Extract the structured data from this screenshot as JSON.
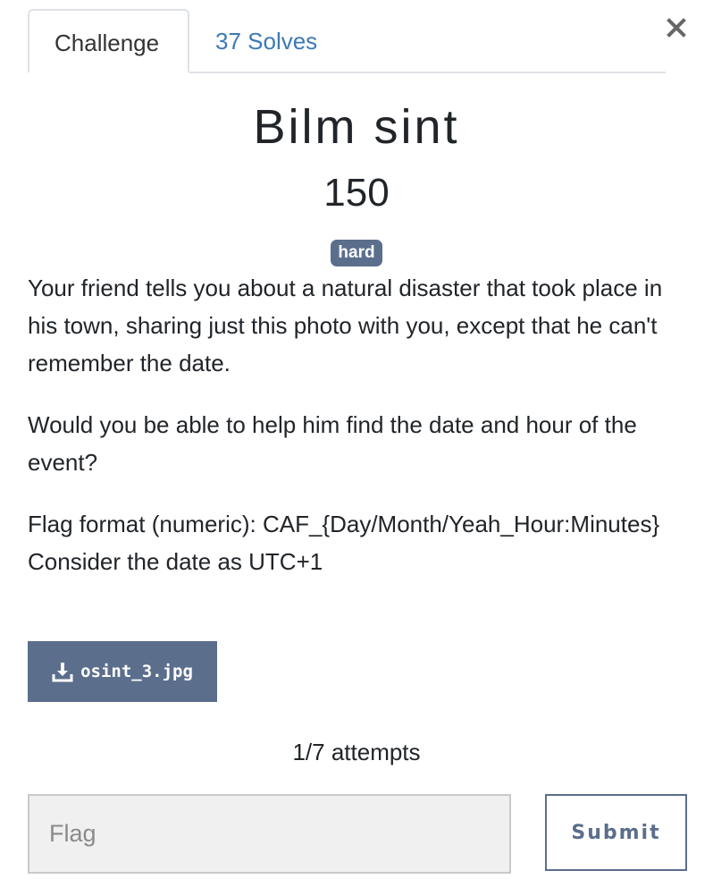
{
  "tabs": [
    {
      "label": "Challenge",
      "active": true
    },
    {
      "label": "37 Solves",
      "active": false
    }
  ],
  "close_icon": "close-icon",
  "challenge": {
    "name": "Bilm sint",
    "points": "150",
    "difficulty": "hard",
    "description": [
      "Your friend tells you about a natural disaster that took place in his town, sharing just this photo with you, except that he can't remember the date.",
      "Would you be able to help him find the date and hour of the event?",
      "Flag format (numeric): CAF_{Day/Month/Yeah_Hour:Minutes} Consider the date as UTC+1"
    ]
  },
  "download": {
    "icon": "download-icon",
    "filename": "osint_3.jpg"
  },
  "attempts": "1/7 attempts",
  "form": {
    "flag_placeholder": "Flag",
    "flag_value": "",
    "submit_label": "Submit"
  },
  "colors": {
    "accent": "#5b6e8c",
    "link": "#3d79b5"
  }
}
